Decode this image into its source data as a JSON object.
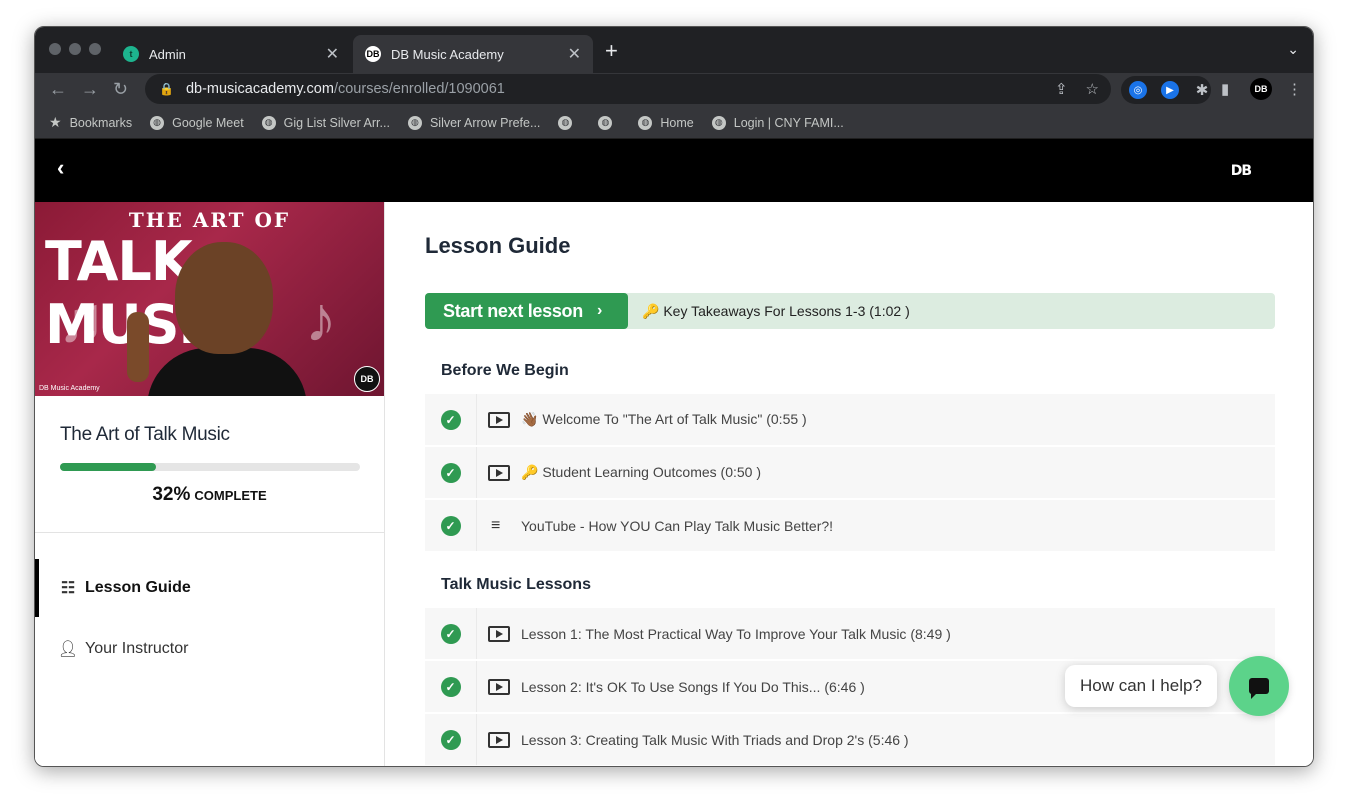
{
  "browser": {
    "tabs": [
      {
        "title": "Admin",
        "favicon": "t",
        "favicon_color": "#1db48e"
      },
      {
        "title": "DB Music Academy",
        "favicon": "DB",
        "favicon_color": "#ffffff"
      }
    ],
    "url_host": "db-musicacademy.com",
    "url_path": "/courses/enrolled/1090061",
    "bookmarks": [
      {
        "label": "Bookmarks",
        "icon": "star-icon"
      },
      {
        "label": "Google Meet",
        "icon": "globe-icon"
      },
      {
        "label": "Gig List Silver Arr...",
        "icon": "globe-icon"
      },
      {
        "label": "Silver Arrow Prefe...",
        "icon": "globe-icon"
      },
      {
        "label": "",
        "icon": "globe-icon"
      },
      {
        "label": "",
        "icon": "globe-icon"
      },
      {
        "label": "Home",
        "icon": "globe-icon"
      },
      {
        "label": "Login | CNY FAMI...",
        "icon": "globe-icon"
      }
    ],
    "profile_badge": "DB"
  },
  "site": {
    "logo": "DB"
  },
  "sidebar": {
    "hero": {
      "line1": "THE ART OF",
      "line2": "TALK MUSIC",
      "caption": "DB Music Academy",
      "badge": "DB"
    },
    "course_title": "The Art of Talk Music",
    "progress_percent": 32,
    "progress_text": "32%",
    "progress_label": "COMPLETE",
    "nav": [
      {
        "label": "Lesson Guide",
        "icon": "list-icon",
        "active": true
      },
      {
        "label": "Your Instructor",
        "icon": "user-icon",
        "active": false
      }
    ]
  },
  "main": {
    "title": "Lesson Guide",
    "start_next_label": "Start next lesson",
    "next_lesson": "🔑 Key Takeaways For Lessons 1-3 (1:02 )",
    "sections": [
      {
        "title": "Before We Begin",
        "lessons": [
          {
            "name": "👋🏾 Welcome To \"The Art of Talk Music\" (0:55 )",
            "type": "video"
          },
          {
            "name": "🔑 Student Learning Outcomes (0:50 )",
            "type": "video"
          },
          {
            "name": "YouTube - How YOU Can Play Talk Music Better?!",
            "type": "text"
          }
        ]
      },
      {
        "title": "Talk Music Lessons",
        "lessons": [
          {
            "name": "Lesson 1: The Most Practical Way To Improve Your Talk Music (8:49 )",
            "type": "video"
          },
          {
            "name": "Lesson 2: It's OK To Use Songs If You Do This... (6:46 )",
            "type": "video"
          },
          {
            "name": "Lesson 3: Creating Talk Music With Triads and Drop 2's (5:46 )",
            "type": "video"
          }
        ]
      }
    ]
  },
  "chat": {
    "prompt": "How can I help?"
  },
  "colors": {
    "accent_green": "#2f9a52",
    "chat_green": "#5cd38a",
    "next_row_bg": "#dcece0"
  }
}
